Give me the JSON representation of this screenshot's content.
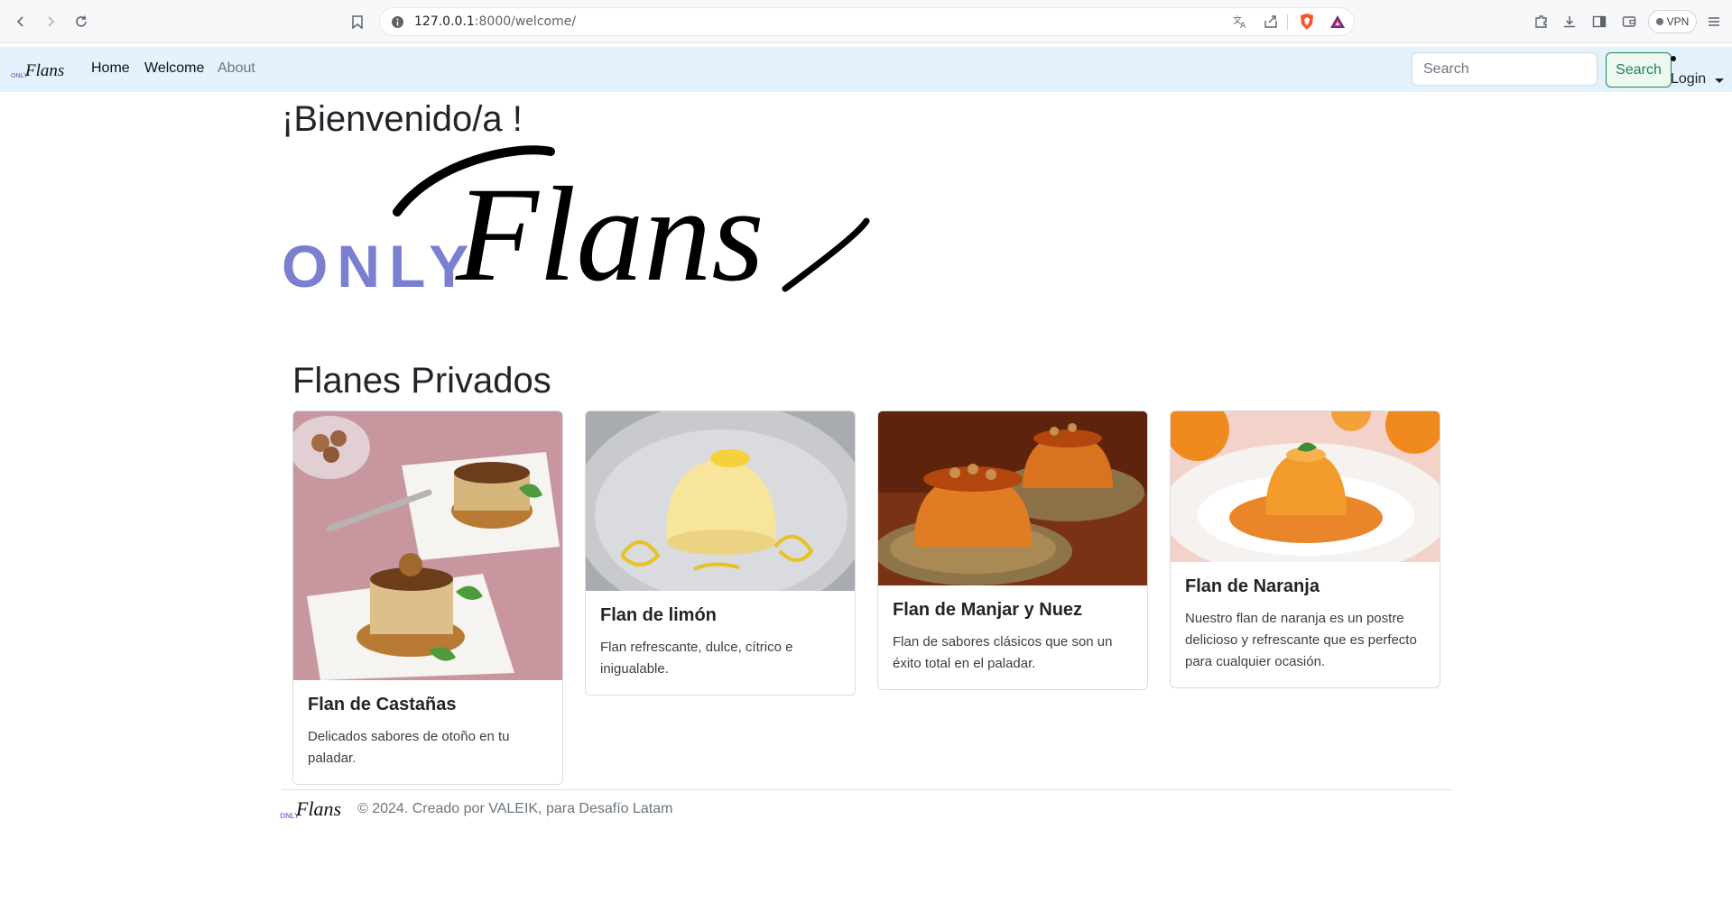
{
  "browser": {
    "url_host": "127.0.0.1",
    "url_rest": ":8000/welcome/",
    "vpn_label": "VPN"
  },
  "navbar": {
    "brand_small": "ONLY",
    "brand_script": "Flans",
    "links": [
      {
        "label": "Home"
      },
      {
        "label": "Welcome"
      },
      {
        "label": "About"
      }
    ],
    "search_placeholder": "Search",
    "search_button": "Search",
    "login_label": "Login"
  },
  "hero": {
    "welcome": "¡Bienvenido/a !",
    "logo_only": "ONLY",
    "logo_flans": "Flans",
    "logo_only_color": "#7a7fcf"
  },
  "section": {
    "title": "Flanes Privados"
  },
  "cards": [
    {
      "title": "Flan de Castañas",
      "text": "Delicados sabores de otoño en tu paladar.",
      "image": "chestnut-flan-photo"
    },
    {
      "title": "Flan de limón",
      "text": "Flan refrescante, dulce, cítrico e inigualable.",
      "image": "lemon-flan-photo"
    },
    {
      "title": "Flan de Manjar y Nuez",
      "text": "Flan de sabores clásicos que son un éxito total en el paladar.",
      "image": "manjar-walnut-flan-photo"
    },
    {
      "title": "Flan de Naranja",
      "text": "Nuestro flan de naranja es un postre delicioso y refrescante que es perfecto para cualquier ocasión.",
      "image": "orange-flan-photo"
    }
  ],
  "footer": {
    "logo_only": "ONLY",
    "logo_flans": "Flans",
    "text": "© 2024. Creado por VALEIK, para Desafío Latam"
  },
  "colors": {
    "navbar_bg": "#e3f2fd",
    "accent_green": "#198754",
    "logo_purple": "#7a7fcf"
  }
}
